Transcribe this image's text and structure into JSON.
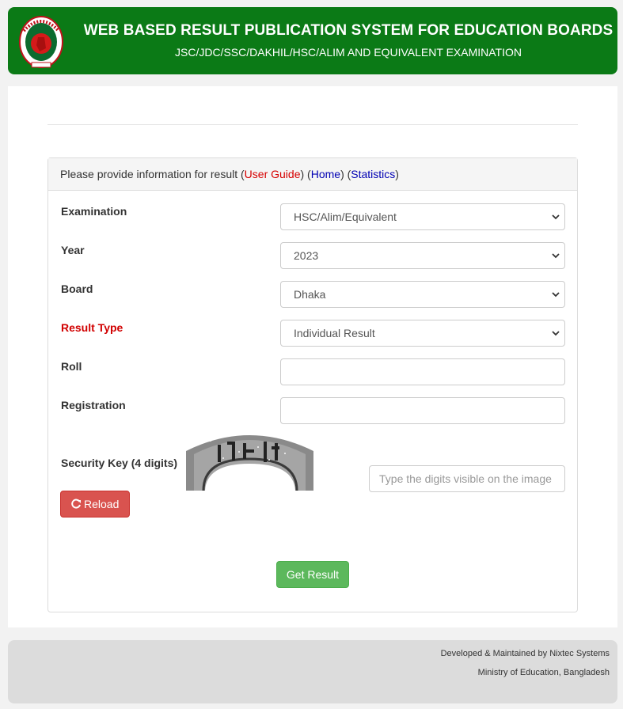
{
  "header": {
    "title": "WEB BASED RESULT PUBLICATION SYSTEM FOR EDUCATION BOARDS",
    "subtitle": "JSC/JDC/SSC/DAKHIL/HSC/ALIM AND EQUIVALENT EXAMINATION",
    "logo_icon": "bangladesh-govt-emblem-icon"
  },
  "panel": {
    "intro": "Please provide information for result (",
    "user_guide": "User Guide",
    "sep1": ") (",
    "home": "Home",
    "sep2": ") (",
    "statistics": "Statistics",
    "close": ")"
  },
  "form": {
    "examination": {
      "label": "Examination",
      "value": "HSC/Alim/Equivalent"
    },
    "year": {
      "label": "Year",
      "value": "2023"
    },
    "board": {
      "label": "Board",
      "value": "Dhaka"
    },
    "result_type": {
      "label": "Result Type",
      "value": "Individual Result"
    },
    "roll": {
      "label": "Roll",
      "value": ""
    },
    "registration": {
      "label": "Registration",
      "value": ""
    },
    "security": {
      "label": "Security Key (4 digits)",
      "placeholder": "Type the digits visible on the image"
    },
    "reload_label": "Reload",
    "submit_label": "Get Result"
  },
  "footer": {
    "line1": "Developed & Maintained by Nixtec Systems",
    "line2": "Ministry of Education, Bangladesh"
  },
  "colors": {
    "header_green": "#0b7a16",
    "label_red": "#d10000",
    "reload_red": "#d9534f",
    "submit_green": "#5cb85c",
    "link_blue": "#0000b3"
  }
}
